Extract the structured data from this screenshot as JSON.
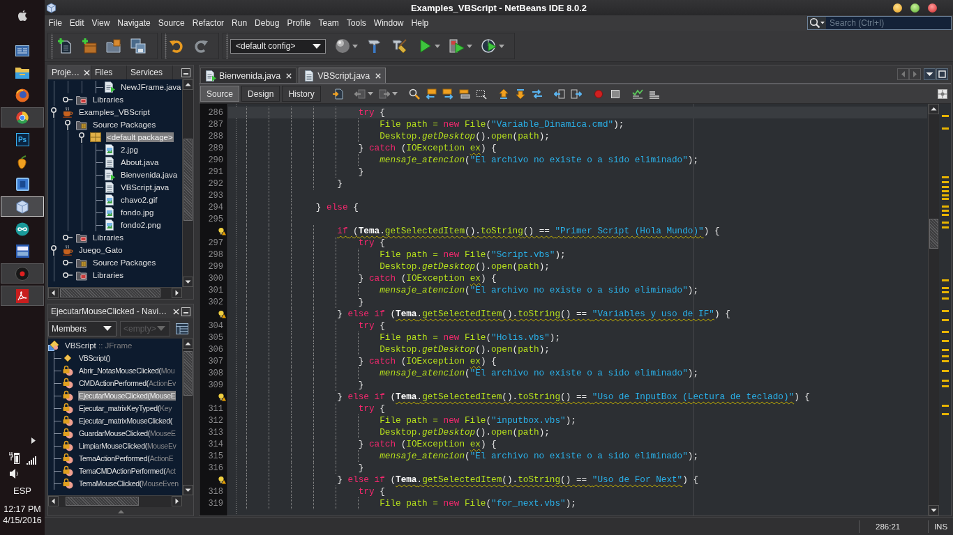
{
  "taskbar": {
    "apps": [
      {
        "kind": "dashboard",
        "running": false,
        "selected": false
      },
      {
        "kind": "folder",
        "running": false,
        "selected": false
      },
      {
        "kind": "orb",
        "running": false,
        "selected": false
      },
      {
        "kind": "wheel",
        "running": true,
        "selected": false
      },
      {
        "kind": "tile",
        "label": "Ps",
        "running": false,
        "selected": false
      },
      {
        "kind": "fruit",
        "running": false,
        "selected": false
      },
      {
        "kind": "square",
        "running": false,
        "selected": false
      },
      {
        "kind": "cube",
        "running": true,
        "selected": true
      },
      {
        "kind": "infinity",
        "running": false,
        "selected": false
      },
      {
        "kind": "monitor",
        "running": false,
        "selected": false
      },
      {
        "kind": "disc",
        "running": true,
        "selected": false
      },
      {
        "kind": "pdf",
        "running": true,
        "selected": false
      }
    ],
    "tray": {
      "language": "ESP",
      "time": "12:17 PM",
      "date": "4/15/2016"
    }
  },
  "window": {
    "title": "Examples_VBScript - NetBeans IDE 8.0.2"
  },
  "menu": [
    "File",
    "Edit",
    "View",
    "Navigate",
    "Source",
    "Refactor",
    "Run",
    "Debug",
    "Profile",
    "Team",
    "Tools",
    "Window",
    "Help"
  ],
  "search": {
    "placeholder": "Search (Ctrl+I)"
  },
  "toolbar": {
    "configuration": "<default config>"
  },
  "projects": {
    "tabs": [
      {
        "label": "Proje…",
        "selected": true,
        "closable": true
      },
      {
        "label": "Files",
        "selected": false,
        "closable": false
      },
      {
        "label": "Services",
        "selected": false,
        "closable": false
      }
    ],
    "tree": [
      {
        "children": [
          {
            "children": [
              {
                "children": [
                  {
                    "label": "NewJFrame.java",
                    "kind": "java-main",
                    "selected": false
                  }
                ]
              }
            ]
          },
          {
            "label": "Libraries",
            "kind": "libraries",
            "expanded": false,
            "selected": false
          }
        ]
      },
      {
        "label": "Examples_VBScript",
        "kind": "project",
        "expanded": true,
        "selected": false,
        "children": [
          {
            "label": "Source Packages",
            "kind": "sources",
            "expanded": true,
            "selected": false,
            "children": [
              {
                "label": "<default package>",
                "kind": "package",
                "expanded": true,
                "selected": true,
                "children": [
                  {
                    "label": "2.jpg",
                    "kind": "image",
                    "selected": false
                  },
                  {
                    "label": "About.java",
                    "kind": "java",
                    "selected": false
                  },
                  {
                    "label": "Bienvenida.java",
                    "kind": "java-main",
                    "selected": false
                  },
                  {
                    "label": "VBScript.java",
                    "kind": "java",
                    "selected": false
                  },
                  {
                    "label": "chavo2.gif",
                    "kind": "image",
                    "selected": false
                  },
                  {
                    "label": "fondo.jpg",
                    "kind": "image",
                    "selected": false
                  },
                  {
                    "label": "fondo2.png",
                    "kind": "image",
                    "selected": false
                  }
                ]
              }
            ]
          },
          {
            "label": "Libraries",
            "kind": "libraries",
            "expanded": false,
            "selected": false
          }
        ]
      },
      {
        "label": "Juego_Gato",
        "kind": "project",
        "expanded": true,
        "selected": false,
        "children": [
          {
            "label": "Source Packages",
            "kind": "sources",
            "expanded": false,
            "selected": false
          },
          {
            "label": "Libraries",
            "kind": "libraries",
            "expanded": false,
            "selected": false
          }
        ]
      }
    ]
  },
  "navigator": {
    "title": "EjecutarMouseClicked - Navi…",
    "filter": {
      "value": "Members",
      "disabled": false
    },
    "scope": {
      "value": "<empty>",
      "disabled": true
    },
    "tree": {
      "label": "VBScript",
      "type": ":: JFrame",
      "kind": "class",
      "selected": false,
      "children": [
        {
          "label": "VBScript()",
          "kind": "constructor",
          "selected": false
        },
        {
          "label": "Abrir_NotasMouseClicked(",
          "parameters": "Mou",
          "kind": "method",
          "selected": false
        },
        {
          "label": "CMDActionPerformed(",
          "parameters": "ActionEv",
          "kind": "method",
          "selected": false
        },
        {
          "label": "EjecutarMouseClicked(",
          "parameters": "MouseE",
          "kind": "method",
          "selected": true
        },
        {
          "label": "Ejecutar_matrixKeyTyped(",
          "parameters": "Key",
          "kind": "method",
          "selected": false
        },
        {
          "label": "Ejecutar_matrixMouseClicked(",
          "kind": "method",
          "selected": false
        },
        {
          "label": "GuardarMouseClicked(",
          "parameters": "MouseE",
          "kind": "method",
          "selected": false
        },
        {
          "label": "LimpiarMouseClicked(",
          "parameters": "MouseEv",
          "kind": "method",
          "selected": false
        },
        {
          "label": "TemaActionPerformed(",
          "parameters": "ActionE",
          "kind": "method",
          "selected": false
        },
        {
          "label": "TemaCMDActionPerformed(",
          "parameters": "Act",
          "kind": "method",
          "selected": false
        },
        {
          "label": "TemaMouseClicked(",
          "parameters": "MouseEven",
          "kind": "method",
          "selected": false
        }
      ]
    }
  },
  "editor": {
    "tabs": [
      {
        "label": "Bienvenida.java",
        "kind": "java-main",
        "selected": false
      },
      {
        "label": "VBScript.java",
        "kind": "java",
        "selected": true
      }
    ],
    "views": [
      {
        "label": "Source",
        "selected": true
      },
      {
        "label": "Design",
        "selected": false
      },
      {
        "label": "History",
        "selected": false
      }
    ],
    "lines": [
      {
        "number": "286",
        "hint": false,
        "current": true,
        "tokens": [
          {
            "kind": "keyword",
            "text": "                        try",
            "warning": false
          },
          {
            "kind": "plain",
            "text": " {",
            "warning": false
          }
        ]
      },
      {
        "number": "287",
        "hint": false,
        "current": false,
        "tokens": [
          {
            "kind": "name",
            "text": "                            File path = ",
            "warning": false
          },
          {
            "kind": "keyword",
            "text": "new",
            "warning": false
          },
          {
            "kind": "name",
            "text": " File",
            "warning": false
          },
          {
            "kind": "plain",
            "text": "(",
            "warning": false
          },
          {
            "kind": "string",
            "text": "\"Variable_Dinamica.cmd\"",
            "warning": false
          },
          {
            "kind": "plain",
            "text": ");",
            "warning": false
          }
        ]
      },
      {
        "number": "288",
        "hint": false,
        "current": false,
        "tokens": [
          {
            "kind": "name",
            "text": "                            Desktop.",
            "warning": false
          },
          {
            "kind": "method",
            "text": "getDesktop",
            "warning": false
          },
          {
            "kind": "plain",
            "text": "().",
            "warning": false
          },
          {
            "kind": "name",
            "text": "open",
            "warning": false
          },
          {
            "kind": "plain",
            "text": "(",
            "warning": false
          },
          {
            "kind": "name",
            "text": "path",
            "warning": false
          },
          {
            "kind": "plain",
            "text": ");",
            "warning": false
          }
        ]
      },
      {
        "number": "289",
        "hint": false,
        "current": false,
        "tokens": [
          {
            "kind": "plain",
            "text": "                        } ",
            "warning": false
          },
          {
            "kind": "keyword",
            "text": "catch",
            "warning": false
          },
          {
            "kind": "plain",
            "text": " (",
            "warning": false
          },
          {
            "kind": "name",
            "text": "IOException ",
            "warning": false
          },
          {
            "kind": "name",
            "text": "ex",
            "warning": true
          },
          {
            "kind": "plain",
            "text": ") {",
            "warning": false
          }
        ]
      },
      {
        "number": "290",
        "hint": false,
        "current": false,
        "tokens": [
          {
            "kind": "method",
            "text": "                            mensaje_atencion",
            "warning": false
          },
          {
            "kind": "plain",
            "text": "(",
            "warning": false
          },
          {
            "kind": "string",
            "text": "\"El archivo no existe o a sido eliminado\"",
            "warning": false
          },
          {
            "kind": "plain",
            "text": ");",
            "warning": false
          }
        ]
      },
      {
        "number": "291",
        "hint": false,
        "current": false,
        "tokens": [
          {
            "kind": "plain",
            "text": "                        }",
            "warning": false
          }
        ]
      },
      {
        "number": "292",
        "hint": false,
        "current": false,
        "tokens": [
          {
            "kind": "plain",
            "text": "                    }",
            "warning": false
          }
        ]
      },
      {
        "number": "293",
        "hint": false,
        "current": false
      },
      {
        "number": "294",
        "hint": false,
        "current": false,
        "tokens": [
          {
            "kind": "plain",
            "text": "                } ",
            "warning": false
          },
          {
            "kind": "keyword",
            "text": "else",
            "warning": false
          },
          {
            "kind": "plain",
            "text": " {",
            "warning": false
          }
        ]
      },
      {
        "number": "295",
        "hint": false,
        "current": false
      },
      {
        "hint": true,
        "current": false,
        "tokens": [
          {
            "kind": "keyword",
            "text": "                    if",
            "warning": true
          },
          {
            "kind": "plain",
            "text": " (",
            "warning": true
          },
          {
            "kind": "field",
            "text": "Tema",
            "warning": true
          },
          {
            "kind": "plain",
            "text": ".",
            "warning": true
          },
          {
            "kind": "name",
            "text": "getSelectedItem",
            "warning": true
          },
          {
            "kind": "plain",
            "text": "().",
            "warning": true
          },
          {
            "kind": "name",
            "text": "toString",
            "warning": true
          },
          {
            "kind": "plain",
            "text": "() == ",
            "warning": true
          },
          {
            "kind": "string",
            "text": "\"Primer Script (Hola Mundo)\"",
            "warning": true
          },
          {
            "kind": "plain",
            "text": ") {",
            "warning": false
          }
        ]
      },
      {
        "number": "297",
        "hint": false,
        "current": false,
        "tokens": [
          {
            "kind": "keyword",
            "text": "                        try",
            "warning": false
          },
          {
            "kind": "plain",
            "text": " {",
            "warning": false
          }
        ]
      },
      {
        "number": "298",
        "hint": false,
        "current": false,
        "tokens": [
          {
            "kind": "name",
            "text": "                            File path = ",
            "warning": false
          },
          {
            "kind": "keyword",
            "text": "new",
            "warning": false
          },
          {
            "kind": "name",
            "text": " File",
            "warning": false
          },
          {
            "kind": "plain",
            "text": "(",
            "warning": false
          },
          {
            "kind": "string",
            "text": "\"Script.vbs\"",
            "warning": false
          },
          {
            "kind": "plain",
            "text": ");",
            "warning": false
          }
        ]
      },
      {
        "number": "299",
        "hint": false,
        "current": false,
        "tokens": [
          {
            "kind": "name",
            "text": "                            Desktop.",
            "warning": false
          },
          {
            "kind": "method",
            "text": "getDesktop",
            "warning": false
          },
          {
            "kind": "plain",
            "text": "().",
            "warning": false
          },
          {
            "kind": "name",
            "text": "open",
            "warning": false
          },
          {
            "kind": "plain",
            "text": "(",
            "warning": false
          },
          {
            "kind": "name",
            "text": "path",
            "warning": false
          },
          {
            "kind": "plain",
            "text": ");",
            "warning": false
          }
        ]
      },
      {
        "number": "300",
        "hint": false,
        "current": false,
        "tokens": [
          {
            "kind": "plain",
            "text": "                        } ",
            "warning": false
          },
          {
            "kind": "keyword",
            "text": "catch",
            "warning": false
          },
          {
            "kind": "plain",
            "text": " (",
            "warning": false
          },
          {
            "kind": "name",
            "text": "IOException ",
            "warning": false
          },
          {
            "kind": "name",
            "text": "ex",
            "warning": true
          },
          {
            "kind": "plain",
            "text": ") {",
            "warning": false
          }
        ]
      },
      {
        "number": "301",
        "hint": false,
        "current": false,
        "tokens": [
          {
            "kind": "method",
            "text": "                            mensaje_atencion",
            "warning": false
          },
          {
            "kind": "plain",
            "text": "(",
            "warning": false
          },
          {
            "kind": "string",
            "text": "\"El archivo no existe o a sido eliminado\"",
            "warning": false
          },
          {
            "kind": "plain",
            "text": ");",
            "warning": false
          }
        ]
      },
      {
        "number": "302",
        "hint": false,
        "current": false,
        "tokens": [
          {
            "kind": "plain",
            "text": "                        }",
            "warning": false
          }
        ]
      },
      {
        "hint": true,
        "current": false,
        "tokens": [
          {
            "kind": "plain",
            "text": "                    } ",
            "warning": false
          },
          {
            "kind": "keyword",
            "text": "else if",
            "warning": false
          },
          {
            "kind": "plain",
            "text": " (",
            "warning": false
          },
          {
            "kind": "field",
            "text": "Tema",
            "warning": true
          },
          {
            "kind": "plain",
            "text": ".",
            "warning": true
          },
          {
            "kind": "name",
            "text": "getSelectedItem",
            "warning": true
          },
          {
            "kind": "plain",
            "text": "().",
            "warning": true
          },
          {
            "kind": "name",
            "text": "toString",
            "warning": true
          },
          {
            "kind": "plain",
            "text": "() == ",
            "warning": true
          },
          {
            "kind": "string",
            "text": "\"Variables y uso de IF\"",
            "warning": true
          },
          {
            "kind": "plain",
            "text": ") {",
            "warning": false
          }
        ]
      },
      {
        "number": "304",
        "hint": false,
        "current": false,
        "tokens": [
          {
            "kind": "keyword",
            "text": "                        try",
            "warning": false
          },
          {
            "kind": "plain",
            "text": " {",
            "warning": false
          }
        ]
      },
      {
        "number": "305",
        "hint": false,
        "current": false,
        "tokens": [
          {
            "kind": "name",
            "text": "                            File path = ",
            "warning": false
          },
          {
            "kind": "keyword",
            "text": "new",
            "warning": false
          },
          {
            "kind": "name",
            "text": " File",
            "warning": false
          },
          {
            "kind": "plain",
            "text": "(",
            "warning": false
          },
          {
            "kind": "string",
            "text": "\"Holis.vbs\"",
            "warning": false
          },
          {
            "kind": "plain",
            "text": ");",
            "warning": false
          }
        ]
      },
      {
        "number": "306",
        "hint": false,
        "current": false,
        "tokens": [
          {
            "kind": "name",
            "text": "                            Desktop.",
            "warning": false
          },
          {
            "kind": "method",
            "text": "getDesktop",
            "warning": false
          },
          {
            "kind": "plain",
            "text": "().",
            "warning": false
          },
          {
            "kind": "name",
            "text": "open",
            "warning": false
          },
          {
            "kind": "plain",
            "text": "(",
            "warning": false
          },
          {
            "kind": "name",
            "text": "path",
            "warning": false
          },
          {
            "kind": "plain",
            "text": ");",
            "warning": false
          }
        ]
      },
      {
        "number": "307",
        "hint": false,
        "current": false,
        "tokens": [
          {
            "kind": "plain",
            "text": "                        } ",
            "warning": false
          },
          {
            "kind": "keyword",
            "text": "catch",
            "warning": false
          },
          {
            "kind": "plain",
            "text": " (",
            "warning": false
          },
          {
            "kind": "name",
            "text": "IOException ",
            "warning": false
          },
          {
            "kind": "name",
            "text": "ex",
            "warning": true
          },
          {
            "kind": "plain",
            "text": ") {",
            "warning": false
          }
        ]
      },
      {
        "number": "308",
        "hint": false,
        "current": false,
        "tokens": [
          {
            "kind": "method",
            "text": "                            mensaje_atencion",
            "warning": false
          },
          {
            "kind": "plain",
            "text": "(",
            "warning": false
          },
          {
            "kind": "string",
            "text": "\"El archivo no existe o a sido eliminado\"",
            "warning": false
          },
          {
            "kind": "plain",
            "text": ");",
            "warning": false
          }
        ]
      },
      {
        "number": "309",
        "hint": false,
        "current": false,
        "tokens": [
          {
            "kind": "plain",
            "text": "                        }",
            "warning": false
          }
        ]
      },
      {
        "hint": true,
        "current": false,
        "tokens": [
          {
            "kind": "plain",
            "text": "                    } ",
            "warning": false
          },
          {
            "kind": "keyword",
            "text": "else if",
            "warning": false
          },
          {
            "kind": "plain",
            "text": " (",
            "warning": false
          },
          {
            "kind": "field",
            "text": "Tema",
            "warning": true
          },
          {
            "kind": "plain",
            "text": ".",
            "warning": true
          },
          {
            "kind": "name",
            "text": "getSelectedItem",
            "warning": true
          },
          {
            "kind": "plain",
            "text": "().",
            "warning": true
          },
          {
            "kind": "name",
            "text": "toString",
            "warning": true
          },
          {
            "kind": "plain",
            "text": "() == ",
            "warning": true
          },
          {
            "kind": "string",
            "text": "\"Uso de InputBox (Lectura de teclado)\"",
            "warning": true
          },
          {
            "kind": "plain",
            "text": ") {",
            "warning": false
          }
        ]
      },
      {
        "number": "311",
        "hint": false,
        "current": false,
        "tokens": [
          {
            "kind": "keyword",
            "text": "                        try",
            "warning": false
          },
          {
            "kind": "plain",
            "text": " {",
            "warning": false
          }
        ]
      },
      {
        "number": "312",
        "hint": false,
        "current": false,
        "tokens": [
          {
            "kind": "name",
            "text": "                            File path = ",
            "warning": false
          },
          {
            "kind": "keyword",
            "text": "new",
            "warning": false
          },
          {
            "kind": "name",
            "text": " File",
            "warning": false
          },
          {
            "kind": "plain",
            "text": "(",
            "warning": false
          },
          {
            "kind": "string",
            "text": "\"inputbox.vbs\"",
            "warning": false
          },
          {
            "kind": "plain",
            "text": ");",
            "warning": false
          }
        ]
      },
      {
        "number": "313",
        "hint": false,
        "current": false,
        "tokens": [
          {
            "kind": "name",
            "text": "                            Desktop.",
            "warning": false
          },
          {
            "kind": "method",
            "text": "getDesktop",
            "warning": false
          },
          {
            "kind": "plain",
            "text": "().",
            "warning": false
          },
          {
            "kind": "name",
            "text": "open",
            "warning": false
          },
          {
            "kind": "plain",
            "text": "(",
            "warning": false
          },
          {
            "kind": "name",
            "text": "path",
            "warning": false
          },
          {
            "kind": "plain",
            "text": ");",
            "warning": false
          }
        ]
      },
      {
        "number": "314",
        "hint": false,
        "current": false,
        "tokens": [
          {
            "kind": "plain",
            "text": "                        } ",
            "warning": false
          },
          {
            "kind": "keyword",
            "text": "catch",
            "warning": false
          },
          {
            "kind": "plain",
            "text": " (",
            "warning": false
          },
          {
            "kind": "name",
            "text": "IOException ",
            "warning": false
          },
          {
            "kind": "name",
            "text": "ex",
            "warning": true
          },
          {
            "kind": "plain",
            "text": ") {",
            "warning": false
          }
        ]
      },
      {
        "number": "315",
        "hint": false,
        "current": false,
        "tokens": [
          {
            "kind": "method",
            "text": "                            mensaje_atencion",
            "warning": false
          },
          {
            "kind": "plain",
            "text": "(",
            "warning": false
          },
          {
            "kind": "string",
            "text": "\"El archivo no existe o a sido eliminado\"",
            "warning": false
          },
          {
            "kind": "plain",
            "text": ");",
            "warning": false
          }
        ]
      },
      {
        "number": "316",
        "hint": false,
        "current": false,
        "tokens": [
          {
            "kind": "plain",
            "text": "                        }",
            "warning": false
          }
        ]
      },
      {
        "hint": true,
        "current": false,
        "tokens": [
          {
            "kind": "plain",
            "text": "                    } ",
            "warning": false
          },
          {
            "kind": "keyword",
            "text": "else if",
            "warning": false
          },
          {
            "kind": "plain",
            "text": " (",
            "warning": false
          },
          {
            "kind": "field",
            "text": "Tema",
            "warning": true
          },
          {
            "kind": "plain",
            "text": ".",
            "warning": true
          },
          {
            "kind": "name",
            "text": "getSelectedItem",
            "warning": true
          },
          {
            "kind": "plain",
            "text": "().",
            "warning": true
          },
          {
            "kind": "name",
            "text": "toString",
            "warning": true
          },
          {
            "kind": "plain",
            "text": "() == ",
            "warning": true
          },
          {
            "kind": "string",
            "text": "\"Uso de For Next\"",
            "warning": true
          },
          {
            "kind": "plain",
            "text": ") {",
            "warning": false
          }
        ]
      },
      {
        "number": "318",
        "hint": false,
        "current": false,
        "tokens": [
          {
            "kind": "keyword",
            "text": "                        try",
            "warning": false
          },
          {
            "kind": "plain",
            "text": " {",
            "warning": false
          }
        ]
      },
      {
        "number": "319",
        "hint": false,
        "current": false,
        "tokens": [
          {
            "kind": "name",
            "text": "                            File path = ",
            "warning": false
          },
          {
            "kind": "keyword",
            "text": "new",
            "warning": false
          },
          {
            "kind": "name",
            "text": " File",
            "warning": false
          },
          {
            "kind": "plain",
            "text": "(",
            "warning": false
          },
          {
            "kind": "string",
            "text": "\"for_next.vbs\"",
            "warning": false
          },
          {
            "kind": "plain",
            "text": ");",
            "warning": false
          }
        ]
      }
    ]
  },
  "status_bar": {
    "position": "286:21",
    "mode": "INS"
  }
}
